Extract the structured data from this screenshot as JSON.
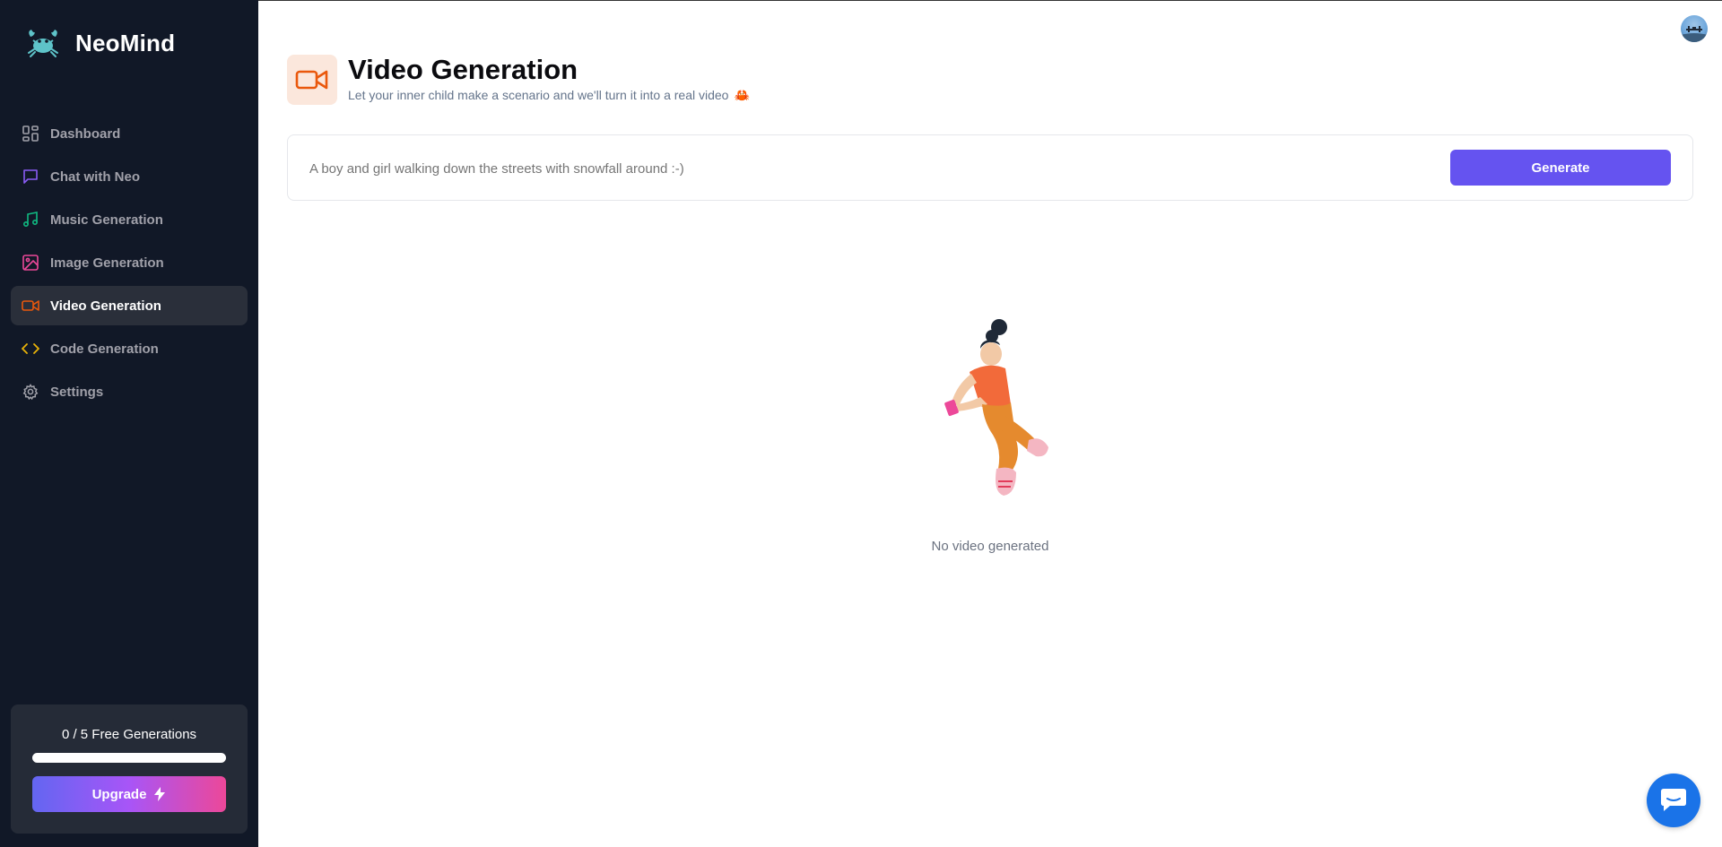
{
  "brand": {
    "name": "NeoMind",
    "logo_icon": "crab-logo-icon"
  },
  "sidebar": {
    "items": [
      {
        "label": "Dashboard",
        "icon": "dashboard-grid-icon",
        "color": "#a1a1aa",
        "active": false
      },
      {
        "label": "Chat with Neo",
        "icon": "chat-bubble-icon",
        "color": "#8b5cf6",
        "active": false
      },
      {
        "label": "Music Generation",
        "icon": "music-note-icon",
        "color": "#10b981",
        "active": false
      },
      {
        "label": "Image Generation",
        "icon": "image-icon",
        "color": "#ec4899",
        "active": false
      },
      {
        "label": "Video Generation",
        "icon": "video-camera-icon",
        "color": "#ea580c",
        "active": true
      },
      {
        "label": "Code Generation",
        "icon": "code-brackets-icon",
        "color": "#eab308",
        "active": false
      },
      {
        "label": "Settings",
        "icon": "gear-icon",
        "color": "#a1a1aa",
        "active": false
      }
    ],
    "free_card": {
      "text": "0 / 5 Free Generations",
      "used": 0,
      "total": 5,
      "upgrade_label": "Upgrade",
      "upgrade_icon": "lightning-bolt-icon"
    }
  },
  "header": {
    "title": "Video Generation",
    "subtitle": "Let your inner child make a scenario and we'll turn it into a real video",
    "subtitle_emoji": "🦀",
    "icon": "video-camera-icon",
    "accent": "#ea580c"
  },
  "prompt": {
    "placeholder": "A boy and girl walking down the streets with snowfall around :-)",
    "value": "",
    "generate_label": "Generate"
  },
  "empty_state": {
    "text": "No video generated",
    "illustration": "person-illustration"
  },
  "colors": {
    "sidebar_bg": "#111827",
    "primary": "#6553f0",
    "chat_fab": "#1a73e8"
  },
  "chat_widget": {
    "icon": "chat-widget-icon"
  }
}
